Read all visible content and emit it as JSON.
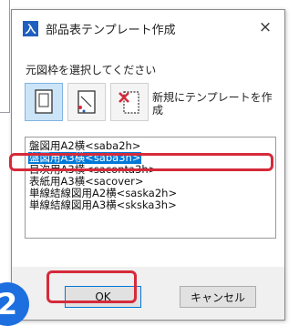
{
  "window": {
    "title": "部品表テンプレート作成",
    "close_glyph": "×",
    "app_icon_glyph": "入"
  },
  "prompt": "元図枠を選択してください",
  "toolbar": {
    "new_template_label": "新規にテンプレートを作成"
  },
  "templates": [
    {
      "label": "盤図用A2横<saba2h>",
      "selected": false
    },
    {
      "label": "盤図用A3横<saba3h>",
      "selected": true
    },
    {
      "label": "目次用A3横<saconta3h>",
      "selected": false
    },
    {
      "label": "表紙用A3横<sacover>",
      "selected": false
    },
    {
      "label": "単線結線図用A2横<saska2h>",
      "selected": false
    },
    {
      "label": "単線結線図用A3横<skska3h>",
      "selected": false
    }
  ],
  "buttons": {
    "ok": "OK",
    "cancel": "キャンセル"
  },
  "step_badge": "2",
  "colors": {
    "selection": "#0078d7",
    "highlight": "#d62a3a",
    "badge": "#1d6fe0"
  }
}
